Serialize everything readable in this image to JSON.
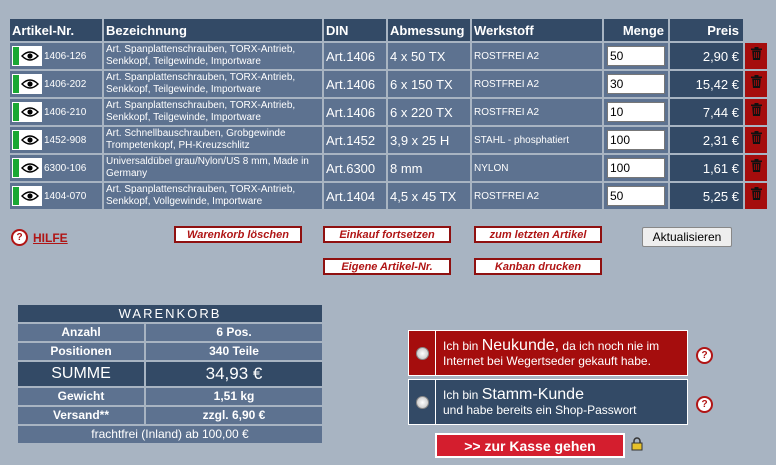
{
  "table": {
    "headers": {
      "artnr": "Artikel-Nr.",
      "bez": "Bezeichnung",
      "din": "DIN",
      "abm": "Abmessung",
      "werk": "Werkstoff",
      "menge": "Menge",
      "preis": "Preis"
    },
    "rows": [
      {
        "artnr": "1406-126",
        "bez": "Art. Spanplattenschrauben, TORX-Antrieb, Senkkopf, Teilgewinde, Importware",
        "din": "Art.1406",
        "abm": "4 x 50 TX",
        "werk": "ROSTFREI A2",
        "menge": "50",
        "preis": "2,90 €"
      },
      {
        "artnr": "1406-202",
        "bez": "Art. Spanplattenschrauben, TORX-Antrieb, Senkkopf, Teilgewinde, Importware",
        "din": "Art.1406",
        "abm": "6 x 150 TX",
        "werk": "ROSTFREI A2",
        "menge": "30",
        "preis": "15,42 €"
      },
      {
        "artnr": "1406-210",
        "bez": "Art. Spanplattenschrauben, TORX-Antrieb, Senkkopf, Teilgewinde, Importware",
        "din": "Art.1406",
        "abm": "6 x 220 TX",
        "werk": "ROSTFREI A2",
        "menge": "10",
        "preis": "7,44 €"
      },
      {
        "artnr": "1452-908",
        "bez": "Art. Schnellbauschrauben, Grobgewinde Trompetenkopf, PH-Kreuzschlitz",
        "din": "Art.1452",
        "abm": "3,9 x 25 H",
        "werk": "STAHL - phosphatiert",
        "menge": "100",
        "preis": "2,31 €"
      },
      {
        "artnr": "6300-106",
        "bez": "Universaldübel grau/Nylon/US 8 mm, Made in Germany",
        "din": "Art.6300",
        "abm": "8 mm",
        "werk": "NYLON",
        "menge": "100",
        "preis": "1,61 €"
      },
      {
        "artnr": "1404-070",
        "bez": "Art. Spanplattenschrauben, TORX-Antrieb, Senkkopf, Vollgewinde, Importware",
        "din": "Art.1404",
        "abm": "4,5 x 45 TX",
        "werk": "ROSTFREI A2",
        "menge": "50",
        "preis": "5,25 €"
      }
    ]
  },
  "actions": {
    "help": "HILFE",
    "clear_cart": "Warenkorb löschen",
    "continue": "Einkauf fortsetzen",
    "last_article": "zum letzten Artikel",
    "update": "Aktualisieren",
    "own_artnr": "Eigene Artikel-Nr.",
    "kanban": "Kanban drucken"
  },
  "warenkorb": {
    "title": "WARENKORB",
    "anzahl_label": "Anzahl",
    "anzahl": "6 Pos.",
    "positionen_label": "Positionen",
    "positionen": "340 Teile",
    "summe_label": "SUMME",
    "summe": "34,93 €",
    "gewicht_label": "Gewicht",
    "gewicht": "1,51 kg",
    "versand_label": "Versand**",
    "versand": "zzgl. 6,90 €",
    "frachtfrei": "frachtfrei (Inland) ab 100,00 €"
  },
  "customer": {
    "new_pre": "Ich bin ",
    "new_big": "Neukunde,",
    "new_post": " da ich noch nie im Internet bei Wegertseder gekauft habe.",
    "existing_pre": "Ich bin ",
    "existing_big": "Stamm-Kunde",
    "existing_post": "und habe bereits ein Shop-Passwort"
  },
  "checkout": ">> zur Kasse gehen",
  "colors": {
    "header": "#334a66",
    "row": "#5d7290",
    "red": "#a50d0d",
    "checkout": "#d41e2e",
    "background": "#a8b4c2"
  }
}
